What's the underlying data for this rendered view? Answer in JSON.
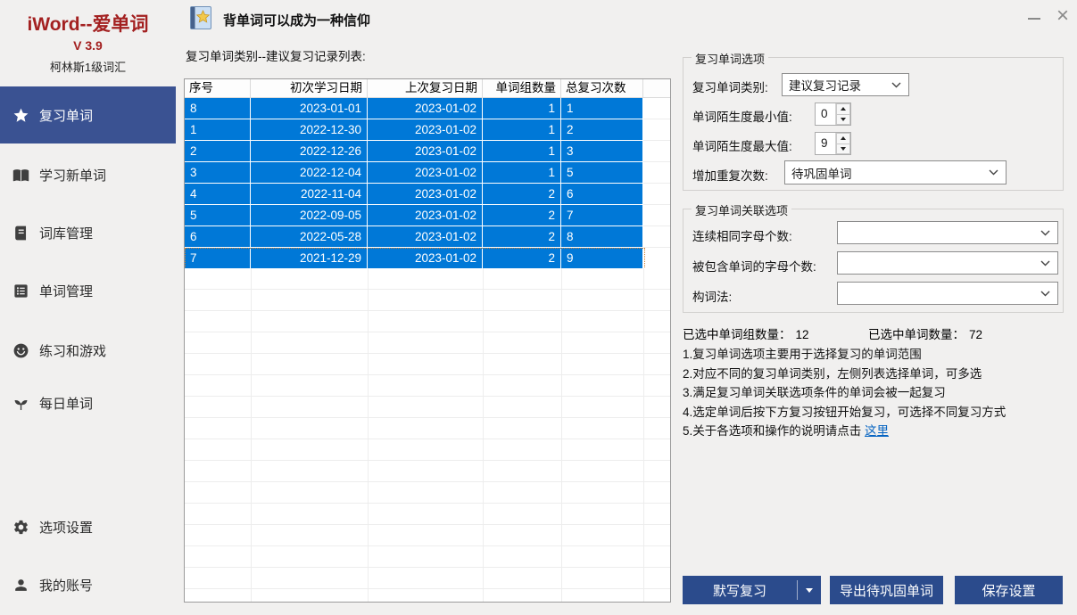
{
  "app": {
    "logo_title": "iWord--爱单词",
    "version": "V 3.9",
    "vocab_name": "柯林斯1级词汇",
    "titlebar_text": "背单词可以成为一种信仰",
    "close_glyph": "×"
  },
  "sidebar": {
    "items": [
      {
        "label": "复习单词",
        "icon": "star-icon",
        "active": true
      },
      {
        "label": "学习新单词",
        "icon": "open-book-icon",
        "active": false
      },
      {
        "label": "词库管理",
        "icon": "book-icon",
        "active": false
      },
      {
        "label": "单词管理",
        "icon": "list-icon",
        "active": false
      },
      {
        "label": "练习和游戏",
        "icon": "smiley-icon",
        "active": false
      },
      {
        "label": "每日单词",
        "icon": "sprout-icon",
        "active": false
      },
      {
        "label": "选项设置",
        "icon": "gear-icon",
        "active": false
      },
      {
        "label": "我的账号",
        "icon": "user-icon",
        "active": false
      }
    ]
  },
  "main": {
    "list_label": "复习单词类别--建议复习记录列表:",
    "table": {
      "headers": [
        "序号",
        "初次学习日期",
        "上次复习日期",
        "单词组数量",
        "总复习次数"
      ],
      "rows": [
        [
          "8",
          "2023-01-01",
          "2023-01-02",
          "1",
          "1"
        ],
        [
          "1",
          "2022-12-30",
          "2023-01-02",
          "1",
          "2"
        ],
        [
          "2",
          "2022-12-26",
          "2023-01-02",
          "1",
          "3"
        ],
        [
          "3",
          "2022-12-04",
          "2023-01-02",
          "1",
          "5"
        ],
        [
          "4",
          "2022-11-04",
          "2023-01-02",
          "2",
          "6"
        ],
        [
          "5",
          "2022-09-05",
          "2023-01-02",
          "2",
          "7"
        ],
        [
          "6",
          "2022-05-28",
          "2023-01-02",
          "2",
          "8"
        ],
        [
          "7",
          "2021-12-29",
          "2023-01-02",
          "2",
          "9"
        ]
      ],
      "all_rows_selected": true,
      "focused_row_index": 7
    }
  },
  "options_panel": {
    "group1": {
      "title": "复习单词选项",
      "category_label": "复习单词类别:",
      "category_value": "建议复习记录",
      "min_label": "单词陌生度最小值:",
      "min_value": "0",
      "max_label": "单词陌生度最大值:",
      "max_value": "9",
      "repeat_label": "增加重复次数:",
      "repeat_value": "待巩固单词"
    },
    "group2": {
      "title": "复习单词关联选项",
      "same_letters_label": "连续相同字母个数:",
      "same_letters_value": "",
      "contained_letters_label": "被包含单词的字母个数:",
      "contained_letters_value": "",
      "word_formation_label": "构词法:",
      "word_formation_value": ""
    },
    "stats": {
      "groups_label": "已选中单词组数量：",
      "groups_value": "12",
      "words_label": "已选中单词数量：",
      "words_value": "72"
    },
    "instructions": [
      "1.复习单词选项主要用于选择复习的单词范围",
      "2.对应不同的复习单词类别，左侧列表选择单词，可多选",
      "3.满足复习单词关联选项条件的单词会被一起复习",
      "4.选定单词后按下方复习按钮开始复习，可选择不同复习方式"
    ],
    "help_line_prefix": "5.关于各选项和操作的说明请点击 ",
    "help_link_text": "这里",
    "buttons": {
      "dictation": "默写复习",
      "export": "导出待巩固单词",
      "save": "保存设置"
    }
  },
  "colors": {
    "sidebar_active": "#3A5292",
    "selection_blue": "#0078D7",
    "button_blue": "#2B4B8C",
    "logo_red": "#A32020",
    "link_blue": "#0563C1",
    "focus_outline": "#D08030"
  }
}
